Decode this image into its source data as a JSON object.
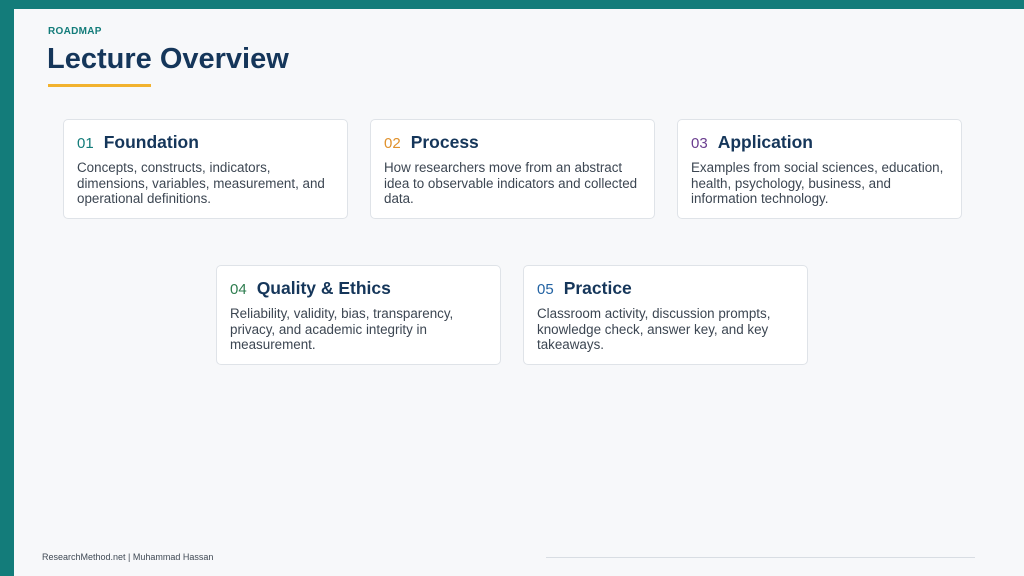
{
  "header": {
    "eyebrow": "ROADMAP",
    "title": "Lecture Overview"
  },
  "colors": {
    "accent": "#137c7a",
    "underline": "#f2b22e",
    "title": "#15365a"
  },
  "cards": [
    {
      "number": "01",
      "title": "Foundation",
      "description": "Concepts, constructs, indicators, dimensions, variables, measurement, and operational definitions.",
      "number_color": "#137c7a"
    },
    {
      "number": "02",
      "title": "Process",
      "description": "How researchers move from an abstract idea to observable indicators and collected data.",
      "number_color": "#e0912c"
    },
    {
      "number": "03",
      "title": "Application",
      "description": "Examples from social sciences, education, health, psychology, business, and information technology.",
      "number_color": "#6a3d8f"
    },
    {
      "number": "04",
      "title": "Quality & Ethics",
      "description": "Reliability, validity, bias, transparency, privacy, and academic integrity in measurement.",
      "number_color": "#2e7d4f"
    },
    {
      "number": "05",
      "title": "Practice",
      "description": "Classroom activity, discussion prompts, knowledge check, answer key, and key takeaways.",
      "number_color": "#2363a3"
    }
  ],
  "footer": {
    "text": "ResearchMethod.net | Muhammad Hassan"
  }
}
